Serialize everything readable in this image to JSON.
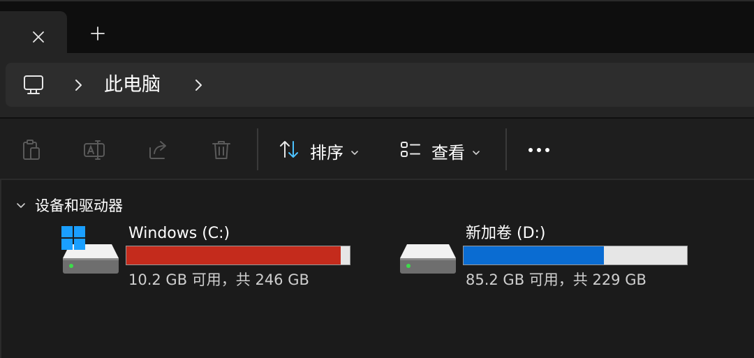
{
  "tabs": {
    "close_icon": "close-icon",
    "new_tab_icon": "plus-icon"
  },
  "address": {
    "root_icon": "computer-icon",
    "crumbs": [
      "此电脑"
    ]
  },
  "toolbar": {
    "actions": [
      "copy-icon",
      "rename-icon",
      "share-icon",
      "delete-icon"
    ],
    "sort_label": "排序",
    "view_label": "查看",
    "more_icon": "more-icon"
  },
  "group": {
    "title": "设备和驱动器",
    "expanded": true
  },
  "drives": [
    {
      "name": "Windows (C:)",
      "free_text": "10.2 GB 可用，共 246 GB",
      "used_fraction": 0.9585,
      "bar_color": "#c42b1c",
      "system_drive": true
    },
    {
      "name": "新加卷 (D:)",
      "free_text": "85.2 GB 可用，共 229 GB",
      "used_fraction": 0.628,
      "bar_color": "#0a6cd2",
      "system_drive": false
    }
  ],
  "colors": {
    "accent_blue": "#0a6cd2",
    "warning_red": "#c42b1c",
    "bar_track": "#e6e6e6"
  }
}
